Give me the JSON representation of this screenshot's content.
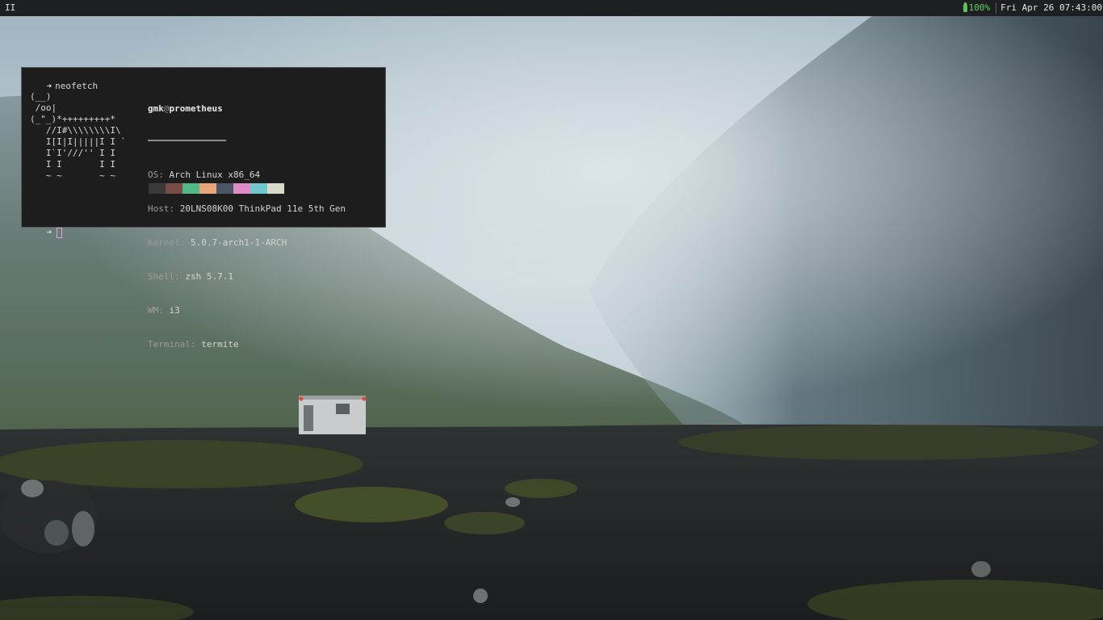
{
  "bar": {
    "workspace": "II",
    "battery": "100%",
    "clock": "Fri Apr 26 07:43:00",
    "battery_color": "#5fd75f"
  },
  "terminal": {
    "command": "neofetch",
    "logo_lines": [
      "(__)",
      " /oo|",
      "(_\"_)*+++++++++*",
      "   //I#\\\\\\\\\\\\\\\\I\\",
      "   I[I|I|||||I I `",
      "   I`I'///'' I I",
      "   I I       I I",
      "   ~ ~       ~ ~"
    ],
    "user": "gmk",
    "at": "@",
    "host": "prometheus",
    "info": [
      {
        "key": "OS:",
        "value": "Arch Linux x86_64"
      },
      {
        "key": "Host:",
        "value": "20LNS08K00 ThinkPad 11e 5th Gen"
      },
      {
        "key": "Kernel:",
        "value": "5.0.7-arch1-1-ARCH"
      },
      {
        "key": "Shell:",
        "value": "zsh 5.7.1"
      },
      {
        "key": "WM:",
        "value": "i3"
      },
      {
        "key": "Terminal:",
        "value": "termite"
      }
    ],
    "palette": [
      "#3a3a3a",
      "#7a4b47",
      "#52b886",
      "#e8a57c",
      "#4c5566",
      "#e08ac8",
      "#6fc8cc",
      "#dadac8"
    ]
  }
}
